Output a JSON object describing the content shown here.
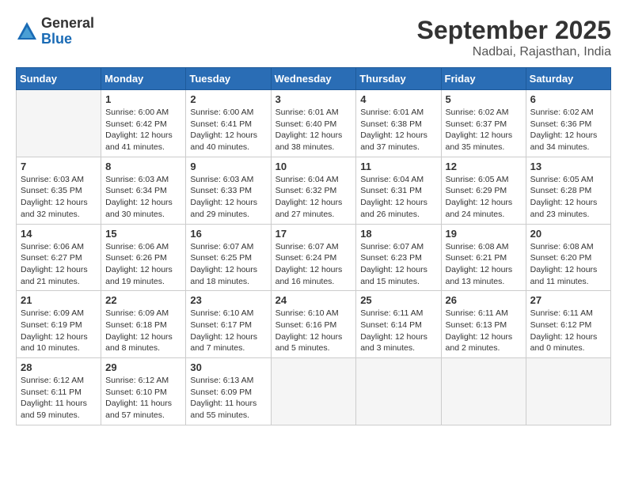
{
  "header": {
    "logo_general": "General",
    "logo_blue": "Blue",
    "month_title": "September 2025",
    "subtitle": "Nadbai, Rajasthan, India"
  },
  "days_of_week": [
    "Sunday",
    "Monday",
    "Tuesday",
    "Wednesday",
    "Thursday",
    "Friday",
    "Saturday"
  ],
  "weeks": [
    [
      {
        "day": "",
        "detail": ""
      },
      {
        "day": "1",
        "detail": "Sunrise: 6:00 AM\nSunset: 6:42 PM\nDaylight: 12 hours\nand 41 minutes."
      },
      {
        "day": "2",
        "detail": "Sunrise: 6:00 AM\nSunset: 6:41 PM\nDaylight: 12 hours\nand 40 minutes."
      },
      {
        "day": "3",
        "detail": "Sunrise: 6:01 AM\nSunset: 6:40 PM\nDaylight: 12 hours\nand 38 minutes."
      },
      {
        "day": "4",
        "detail": "Sunrise: 6:01 AM\nSunset: 6:38 PM\nDaylight: 12 hours\nand 37 minutes."
      },
      {
        "day": "5",
        "detail": "Sunrise: 6:02 AM\nSunset: 6:37 PM\nDaylight: 12 hours\nand 35 minutes."
      },
      {
        "day": "6",
        "detail": "Sunrise: 6:02 AM\nSunset: 6:36 PM\nDaylight: 12 hours\nand 34 minutes."
      }
    ],
    [
      {
        "day": "7",
        "detail": "Sunrise: 6:03 AM\nSunset: 6:35 PM\nDaylight: 12 hours\nand 32 minutes."
      },
      {
        "day": "8",
        "detail": "Sunrise: 6:03 AM\nSunset: 6:34 PM\nDaylight: 12 hours\nand 30 minutes."
      },
      {
        "day": "9",
        "detail": "Sunrise: 6:03 AM\nSunset: 6:33 PM\nDaylight: 12 hours\nand 29 minutes."
      },
      {
        "day": "10",
        "detail": "Sunrise: 6:04 AM\nSunset: 6:32 PM\nDaylight: 12 hours\nand 27 minutes."
      },
      {
        "day": "11",
        "detail": "Sunrise: 6:04 AM\nSunset: 6:31 PM\nDaylight: 12 hours\nand 26 minutes."
      },
      {
        "day": "12",
        "detail": "Sunrise: 6:05 AM\nSunset: 6:29 PM\nDaylight: 12 hours\nand 24 minutes."
      },
      {
        "day": "13",
        "detail": "Sunrise: 6:05 AM\nSunset: 6:28 PM\nDaylight: 12 hours\nand 23 minutes."
      }
    ],
    [
      {
        "day": "14",
        "detail": "Sunrise: 6:06 AM\nSunset: 6:27 PM\nDaylight: 12 hours\nand 21 minutes."
      },
      {
        "day": "15",
        "detail": "Sunrise: 6:06 AM\nSunset: 6:26 PM\nDaylight: 12 hours\nand 19 minutes."
      },
      {
        "day": "16",
        "detail": "Sunrise: 6:07 AM\nSunset: 6:25 PM\nDaylight: 12 hours\nand 18 minutes."
      },
      {
        "day": "17",
        "detail": "Sunrise: 6:07 AM\nSunset: 6:24 PM\nDaylight: 12 hours\nand 16 minutes."
      },
      {
        "day": "18",
        "detail": "Sunrise: 6:07 AM\nSunset: 6:23 PM\nDaylight: 12 hours\nand 15 minutes."
      },
      {
        "day": "19",
        "detail": "Sunrise: 6:08 AM\nSunset: 6:21 PM\nDaylight: 12 hours\nand 13 minutes."
      },
      {
        "day": "20",
        "detail": "Sunrise: 6:08 AM\nSunset: 6:20 PM\nDaylight: 12 hours\nand 11 minutes."
      }
    ],
    [
      {
        "day": "21",
        "detail": "Sunrise: 6:09 AM\nSunset: 6:19 PM\nDaylight: 12 hours\nand 10 minutes."
      },
      {
        "day": "22",
        "detail": "Sunrise: 6:09 AM\nSunset: 6:18 PM\nDaylight: 12 hours\nand 8 minutes."
      },
      {
        "day": "23",
        "detail": "Sunrise: 6:10 AM\nSunset: 6:17 PM\nDaylight: 12 hours\nand 7 minutes."
      },
      {
        "day": "24",
        "detail": "Sunrise: 6:10 AM\nSunset: 6:16 PM\nDaylight: 12 hours\nand 5 minutes."
      },
      {
        "day": "25",
        "detail": "Sunrise: 6:11 AM\nSunset: 6:14 PM\nDaylight: 12 hours\nand 3 minutes."
      },
      {
        "day": "26",
        "detail": "Sunrise: 6:11 AM\nSunset: 6:13 PM\nDaylight: 12 hours\nand 2 minutes."
      },
      {
        "day": "27",
        "detail": "Sunrise: 6:11 AM\nSunset: 6:12 PM\nDaylight: 12 hours\nand 0 minutes."
      }
    ],
    [
      {
        "day": "28",
        "detail": "Sunrise: 6:12 AM\nSunset: 6:11 PM\nDaylight: 11 hours\nand 59 minutes."
      },
      {
        "day": "29",
        "detail": "Sunrise: 6:12 AM\nSunset: 6:10 PM\nDaylight: 11 hours\nand 57 minutes."
      },
      {
        "day": "30",
        "detail": "Sunrise: 6:13 AM\nSunset: 6:09 PM\nDaylight: 11 hours\nand 55 minutes."
      },
      {
        "day": "",
        "detail": ""
      },
      {
        "day": "",
        "detail": ""
      },
      {
        "day": "",
        "detail": ""
      },
      {
        "day": "",
        "detail": ""
      }
    ]
  ]
}
